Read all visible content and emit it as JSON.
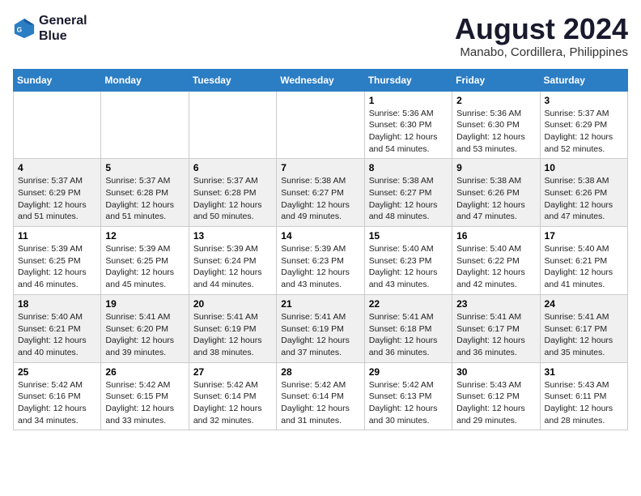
{
  "logo": {
    "line1": "General",
    "line2": "Blue"
  },
  "title": "August 2024",
  "subtitle": "Manabo, Cordillera, Philippines",
  "days_of_week": [
    "Sunday",
    "Monday",
    "Tuesday",
    "Wednesday",
    "Thursday",
    "Friday",
    "Saturday"
  ],
  "weeks": [
    [
      {
        "day": "",
        "content": ""
      },
      {
        "day": "",
        "content": ""
      },
      {
        "day": "",
        "content": ""
      },
      {
        "day": "",
        "content": ""
      },
      {
        "day": "1",
        "content": "Sunrise: 5:36 AM\nSunset: 6:30 PM\nDaylight: 12 hours\nand 54 minutes."
      },
      {
        "day": "2",
        "content": "Sunrise: 5:36 AM\nSunset: 6:30 PM\nDaylight: 12 hours\nand 53 minutes."
      },
      {
        "day": "3",
        "content": "Sunrise: 5:37 AM\nSunset: 6:29 PM\nDaylight: 12 hours\nand 52 minutes."
      }
    ],
    [
      {
        "day": "4",
        "content": "Sunrise: 5:37 AM\nSunset: 6:29 PM\nDaylight: 12 hours\nand 51 minutes."
      },
      {
        "day": "5",
        "content": "Sunrise: 5:37 AM\nSunset: 6:28 PM\nDaylight: 12 hours\nand 51 minutes."
      },
      {
        "day": "6",
        "content": "Sunrise: 5:37 AM\nSunset: 6:28 PM\nDaylight: 12 hours\nand 50 minutes."
      },
      {
        "day": "7",
        "content": "Sunrise: 5:38 AM\nSunset: 6:27 PM\nDaylight: 12 hours\nand 49 minutes."
      },
      {
        "day": "8",
        "content": "Sunrise: 5:38 AM\nSunset: 6:27 PM\nDaylight: 12 hours\nand 48 minutes."
      },
      {
        "day": "9",
        "content": "Sunrise: 5:38 AM\nSunset: 6:26 PM\nDaylight: 12 hours\nand 47 minutes."
      },
      {
        "day": "10",
        "content": "Sunrise: 5:38 AM\nSunset: 6:26 PM\nDaylight: 12 hours\nand 47 minutes."
      }
    ],
    [
      {
        "day": "11",
        "content": "Sunrise: 5:39 AM\nSunset: 6:25 PM\nDaylight: 12 hours\nand 46 minutes."
      },
      {
        "day": "12",
        "content": "Sunrise: 5:39 AM\nSunset: 6:25 PM\nDaylight: 12 hours\nand 45 minutes."
      },
      {
        "day": "13",
        "content": "Sunrise: 5:39 AM\nSunset: 6:24 PM\nDaylight: 12 hours\nand 44 minutes."
      },
      {
        "day": "14",
        "content": "Sunrise: 5:39 AM\nSunset: 6:23 PM\nDaylight: 12 hours\nand 43 minutes."
      },
      {
        "day": "15",
        "content": "Sunrise: 5:40 AM\nSunset: 6:23 PM\nDaylight: 12 hours\nand 43 minutes."
      },
      {
        "day": "16",
        "content": "Sunrise: 5:40 AM\nSunset: 6:22 PM\nDaylight: 12 hours\nand 42 minutes."
      },
      {
        "day": "17",
        "content": "Sunrise: 5:40 AM\nSunset: 6:21 PM\nDaylight: 12 hours\nand 41 minutes."
      }
    ],
    [
      {
        "day": "18",
        "content": "Sunrise: 5:40 AM\nSunset: 6:21 PM\nDaylight: 12 hours\nand 40 minutes."
      },
      {
        "day": "19",
        "content": "Sunrise: 5:41 AM\nSunset: 6:20 PM\nDaylight: 12 hours\nand 39 minutes."
      },
      {
        "day": "20",
        "content": "Sunrise: 5:41 AM\nSunset: 6:19 PM\nDaylight: 12 hours\nand 38 minutes."
      },
      {
        "day": "21",
        "content": "Sunrise: 5:41 AM\nSunset: 6:19 PM\nDaylight: 12 hours\nand 37 minutes."
      },
      {
        "day": "22",
        "content": "Sunrise: 5:41 AM\nSunset: 6:18 PM\nDaylight: 12 hours\nand 36 minutes."
      },
      {
        "day": "23",
        "content": "Sunrise: 5:41 AM\nSunset: 6:17 PM\nDaylight: 12 hours\nand 36 minutes."
      },
      {
        "day": "24",
        "content": "Sunrise: 5:41 AM\nSunset: 6:17 PM\nDaylight: 12 hours\nand 35 minutes."
      }
    ],
    [
      {
        "day": "25",
        "content": "Sunrise: 5:42 AM\nSunset: 6:16 PM\nDaylight: 12 hours\nand 34 minutes."
      },
      {
        "day": "26",
        "content": "Sunrise: 5:42 AM\nSunset: 6:15 PM\nDaylight: 12 hours\nand 33 minutes."
      },
      {
        "day": "27",
        "content": "Sunrise: 5:42 AM\nSunset: 6:14 PM\nDaylight: 12 hours\nand 32 minutes."
      },
      {
        "day": "28",
        "content": "Sunrise: 5:42 AM\nSunset: 6:14 PM\nDaylight: 12 hours\nand 31 minutes."
      },
      {
        "day": "29",
        "content": "Sunrise: 5:42 AM\nSunset: 6:13 PM\nDaylight: 12 hours\nand 30 minutes."
      },
      {
        "day": "30",
        "content": "Sunrise: 5:43 AM\nSunset: 6:12 PM\nDaylight: 12 hours\nand 29 minutes."
      },
      {
        "day": "31",
        "content": "Sunrise: 5:43 AM\nSunset: 6:11 PM\nDaylight: 12 hours\nand 28 minutes."
      }
    ]
  ]
}
